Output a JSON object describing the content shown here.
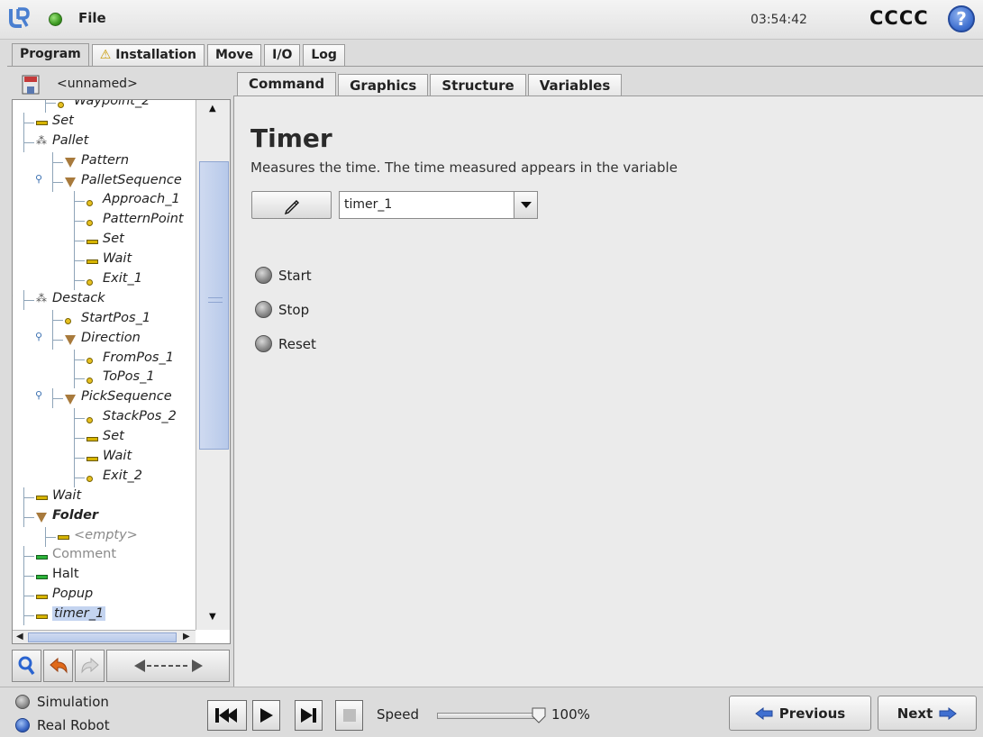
{
  "topbar": {
    "file_label": "File",
    "clock": "03:54:42",
    "robot_name": "CCCC",
    "help_glyph": "?"
  },
  "main_tabs": [
    {
      "label": "Program",
      "active": true
    },
    {
      "label": "Installation",
      "warning_glyph": "⚠"
    },
    {
      "label": "Move"
    },
    {
      "label": "I/O"
    },
    {
      "label": "Log"
    }
  ],
  "program": {
    "name": "<unnamed>"
  },
  "tree": [
    {
      "label": "Waypoint_2",
      "icon": "waypoint-icon"
    },
    {
      "label": "Set",
      "icon": "set-icon"
    },
    {
      "label": "Pallet",
      "icon": "pallet-icon"
    },
    {
      "label": "Pattern",
      "icon": "folder-triangle-icon"
    },
    {
      "label": "PalletSequence",
      "icon": "folder-triangle-icon"
    },
    {
      "label": "Approach_1",
      "icon": "waypoint-icon"
    },
    {
      "label": "PatternPoint",
      "icon": "waypoint-icon"
    },
    {
      "label": "Set",
      "icon": "set-icon"
    },
    {
      "label": "Wait",
      "icon": "wait-icon"
    },
    {
      "label": "Exit_1",
      "icon": "waypoint-icon"
    },
    {
      "label": "Destack",
      "icon": "pallet-icon"
    },
    {
      "label": "StartPos_1",
      "icon": "waypoint-icon"
    },
    {
      "label": "Direction",
      "icon": "folder-triangle-icon"
    },
    {
      "label": "FromPos_1",
      "icon": "waypoint-icon"
    },
    {
      "label": "ToPos_1",
      "icon": "waypoint-icon"
    },
    {
      "label": "PickSequence",
      "icon": "folder-triangle-icon"
    },
    {
      "label": "StackPos_2",
      "icon": "waypoint-icon"
    },
    {
      "label": "Set",
      "icon": "set-icon"
    },
    {
      "label": "Wait",
      "icon": "wait-icon"
    },
    {
      "label": "Exit_2",
      "icon": "waypoint-icon"
    },
    {
      "label": "Wait",
      "icon": "wait-icon"
    },
    {
      "label": "Folder",
      "icon": "folder-triangle-icon"
    },
    {
      "label": "<empty>",
      "icon": "set-icon"
    },
    {
      "label": "Comment",
      "icon": "comment-icon"
    },
    {
      "label": "Halt",
      "icon": "halt-icon"
    },
    {
      "label": "Popup",
      "icon": "popup-icon"
    },
    {
      "label": "timer_1",
      "icon": "timer-icon",
      "selected": true
    }
  ],
  "sub_tabs": [
    {
      "label": "Command",
      "active": true
    },
    {
      "label": "Graphics"
    },
    {
      "label": "Structure"
    },
    {
      "label": "Variables"
    }
  ],
  "command": {
    "title": "Timer",
    "description": "Measures the time. The time measured appears in the variable",
    "variable": "timer_1",
    "options": [
      {
        "label": "Start"
      },
      {
        "label": "Stop"
      },
      {
        "label": "Reset"
      }
    ]
  },
  "bottombar": {
    "modes": [
      {
        "label": "Simulation"
      },
      {
        "label": "Real Robot"
      }
    ],
    "speed_label": "Speed",
    "speed_value": "100%",
    "speed_fraction": 1.0,
    "previous_label": "Previous",
    "next_label": "Next"
  },
  "colors": {
    "accent_blue": "#3e6fcf",
    "selection": "#c4d4f0",
    "set_icon": "#d6b400",
    "halt_icon": "#2db33a"
  }
}
